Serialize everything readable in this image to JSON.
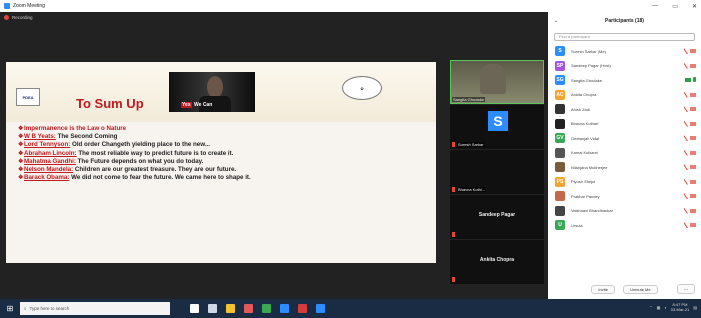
{
  "window": {
    "title": "Zoom Meeting",
    "controls": [
      "—",
      "▭",
      "✕"
    ]
  },
  "recording": {
    "label": "Recording"
  },
  "slide": {
    "title": "To Sum Up",
    "logo_text": "PDEA",
    "photo_caption_yes": "Yes",
    "photo_caption_rest": " We Can",
    "bullets": [
      {
        "marker": "❖",
        "highlight": "",
        "text": "Impermanence is the Law o Nature",
        "style": "plain-red"
      },
      {
        "marker": "❖",
        "highlight": "W B Yeats:",
        "text": " The Second Coming"
      },
      {
        "marker": "❖",
        "highlight": "Lord Tennyson:",
        "text": " Old order Changeth yielding place to the new..."
      },
      {
        "marker": "❖",
        "highlight": "Abraham Lincoln:",
        "text": " The most reliable way to predict future is to create it."
      },
      {
        "marker": "❖",
        "highlight": "Mahatma Gandhi:",
        "text": " The Future depends on what you do today."
      },
      {
        "marker": "❖",
        "highlight": "Nelson Mandela:",
        "text": " Children are our greatest treasure. They are our future."
      },
      {
        "marker": "❖",
        "highlight": "Barack Obama:",
        "text": " We did not come to fear the future. We came here to shape it."
      }
    ]
  },
  "tiles": [
    {
      "name": "Sangita Ghodake",
      "kind": "video"
    },
    {
      "name": "Suresh Sarkar",
      "kind": "avatar",
      "letter": "S"
    },
    {
      "name": "Bhavna Kothi...",
      "kind": "dark"
    },
    {
      "name": "Sandeep Pagar",
      "kind": "name"
    },
    {
      "name": "Ankita Chopra",
      "kind": "name"
    }
  ],
  "participants": {
    "title": "Participants (18)",
    "search_placeholder": "Find a participant",
    "rows": [
      {
        "initial": "S",
        "color": "#2d8cff",
        "name": "Suresh Sarkar (Me)",
        "state": "muted"
      },
      {
        "initial": "SP",
        "color": "#a157d8",
        "name": "Sandeep Pagar (Host)",
        "state": "muted"
      },
      {
        "initial": "SG",
        "color": "#2d8cff",
        "name": "Sangita Ghodake",
        "state": "live"
      },
      {
        "initial": "AC",
        "color": "#f2a531",
        "name": "Ankita Chopra",
        "state": "muted"
      },
      {
        "initial": "",
        "color": "#333333",
        "name": "Anish Zadi",
        "state": "muted"
      },
      {
        "initial": "",
        "color": "#222222",
        "name": "Bhavna Kothari",
        "state": "muted"
      },
      {
        "initial": "GV",
        "color": "#3aa757",
        "name": "Geetanjali Vidal",
        "state": "muted"
      },
      {
        "initial": "",
        "color": "#555555",
        "name": "Kamal Kulkarni",
        "state": "muted"
      },
      {
        "initial": "",
        "color": "#7a5a3a",
        "name": "Nilanjana Mukherjee",
        "state": "muted"
      },
      {
        "initial": "PS",
        "color": "#f2a531",
        "name": "Piyush Shejul",
        "state": "muted"
      },
      {
        "initial": "",
        "color": "#c26a4a",
        "name": "Prakhar Pandey",
        "state": "muted"
      },
      {
        "initial": "",
        "color": "#444444",
        "name": "Vaishnavi Bhandhankar",
        "state": "muted"
      },
      {
        "initial": "U",
        "color": "#3aa757",
        "name": "Ursula",
        "state": "muted"
      }
    ],
    "footer": {
      "invite": "Invite",
      "unmute_me": "Unmute Me",
      "more": "..."
    }
  },
  "taskbar": {
    "search_placeholder": "Type here to search",
    "icons": [
      {
        "name": "cortana-icon",
        "color": "#ffffff"
      },
      {
        "name": "task-view-icon",
        "color": "#cfd8e6"
      },
      {
        "name": "file-explorer-icon",
        "color": "#f4c430"
      },
      {
        "name": "store-icon",
        "color": "#e05a5a"
      },
      {
        "name": "chrome-icon",
        "color": "#38a852"
      },
      {
        "name": "edge-icon",
        "color": "#2d8cff"
      },
      {
        "name": "pdf-icon",
        "color": "#d83b3b"
      },
      {
        "name": "zoom-icon",
        "color": "#2d8cff"
      }
    ],
    "time": "8:47 PM",
    "date": "03-Mar-21"
  }
}
